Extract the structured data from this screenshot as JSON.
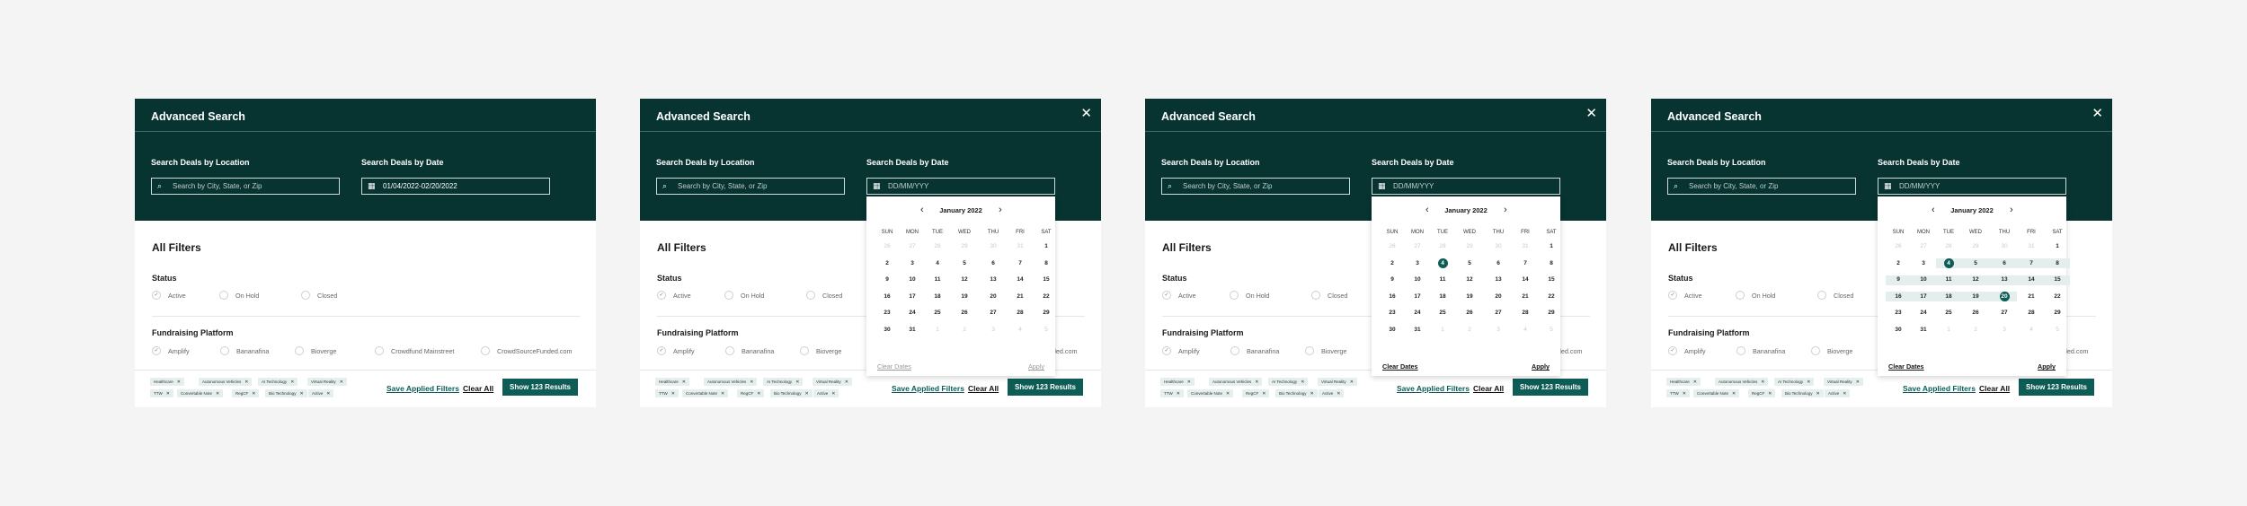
{
  "panels": [
    {
      "title": "Advanced Search",
      "location_label": "Search Deals by Location",
      "location_placeholder": "Search by City, State, or Zip",
      "date_label": "Search Deals by Date",
      "date_value": "01/04/2022-02/20/2022",
      "show_close": false,
      "calendar": null
    },
    {
      "title": "Advanced Search",
      "location_label": "Search Deals by Location",
      "location_placeholder": "Search by City, State, or Zip",
      "date_label": "Search Deals by Date",
      "date_value": "DD/MM/YYY",
      "show_close": true,
      "calendar": {
        "selected": [],
        "range": [],
        "actions_enabled": false
      }
    },
    {
      "title": "Advanced Search",
      "location_label": "Search Deals by Location",
      "location_placeholder": "Search by City, State, or Zip",
      "date_label": "Search Deals by Date",
      "date_value": "DD/MM/YYY",
      "show_close": true,
      "calendar": {
        "selected": [
          4
        ],
        "range": [],
        "actions_enabled": true
      }
    },
    {
      "title": "Advanced Search",
      "location_label": "Search Deals by Location",
      "location_placeholder": "Search by City, State, or Zip",
      "date_label": "Search Deals by Date",
      "date_value": "DD/MM/YYY",
      "show_close": true,
      "calendar": {
        "selected": [
          4,
          20
        ],
        "range": [
          4,
          20
        ],
        "actions_enabled": true
      }
    }
  ],
  "close_glyph": "✕",
  "calendar": {
    "month_label": "January 2022",
    "prev_glyph": "‹",
    "next_glyph": "›",
    "weekdays": [
      "SUN",
      "MON",
      "TUE",
      "WED",
      "THU",
      "FRI",
      "SAT"
    ],
    "weeks": [
      [
        {
          "d": "26",
          "m": true
        },
        {
          "d": "27",
          "m": true
        },
        {
          "d": "28",
          "m": true
        },
        {
          "d": "29",
          "m": true
        },
        {
          "d": "30",
          "m": true
        },
        {
          "d": "31",
          "m": true
        },
        {
          "d": "1",
          "m": false
        }
      ],
      [
        {
          "d": "2",
          "m": false
        },
        {
          "d": "3",
          "m": false
        },
        {
          "d": "4",
          "m": false
        },
        {
          "d": "5",
          "m": false
        },
        {
          "d": "6",
          "m": false
        },
        {
          "d": "7",
          "m": false
        },
        {
          "d": "8",
          "m": false
        }
      ],
      [
        {
          "d": "9",
          "m": false
        },
        {
          "d": "10",
          "m": false
        },
        {
          "d": "11",
          "m": false
        },
        {
          "d": "12",
          "m": false
        },
        {
          "d": "13",
          "m": false
        },
        {
          "d": "14",
          "m": false
        },
        {
          "d": "15",
          "m": false
        }
      ],
      [
        {
          "d": "16",
          "m": false
        },
        {
          "d": "17",
          "m": false
        },
        {
          "d": "18",
          "m": false
        },
        {
          "d": "19",
          "m": false
        },
        {
          "d": "20",
          "m": false
        },
        {
          "d": "21",
          "m": false
        },
        {
          "d": "22",
          "m": false
        }
      ],
      [
        {
          "d": "23",
          "m": false
        },
        {
          "d": "24",
          "m": false
        },
        {
          "d": "25",
          "m": false
        },
        {
          "d": "26",
          "m": false
        },
        {
          "d": "27",
          "m": false
        },
        {
          "d": "28",
          "m": false
        },
        {
          "d": "29",
          "m": false
        }
      ],
      [
        {
          "d": "30",
          "m": false
        },
        {
          "d": "31",
          "m": false
        },
        {
          "d": "1",
          "m": true
        },
        {
          "d": "2",
          "m": true
        },
        {
          "d": "3",
          "m": true
        },
        {
          "d": "4",
          "m": true
        },
        {
          "d": "5",
          "m": true
        }
      ]
    ],
    "clear_label": "Clear Dates",
    "apply_label": "Apply"
  },
  "filters": {
    "title": "All Filters",
    "status": {
      "title": "Status",
      "options": [
        {
          "label": "Active",
          "checked": true
        },
        {
          "label": "On Hold",
          "checked": false
        },
        {
          "label": "Closed",
          "checked": false
        }
      ]
    },
    "platform": {
      "title": "Fundraising Platform",
      "options": [
        {
          "label": "Amplify",
          "checked": true
        },
        {
          "label": "Bananafina",
          "checked": false
        },
        {
          "label": "Bioverge",
          "checked": false
        },
        {
          "label": "Crowdfund Mainstreet",
          "checked": false
        },
        {
          "label": "CrowdSourceFunded.com",
          "checked": false
        }
      ]
    },
    "check_glyph": "✓"
  },
  "chips": {
    "row1": [
      "Healthcare",
      "Autonomous Vehicles",
      "AI Technology",
      "Virtual Reality"
    ],
    "row2": [
      "TTW",
      "Convertable Note",
      "RegCF",
      "Bio Technology",
      "Active"
    ],
    "remove_glyph": "✕"
  },
  "footer": {
    "save_label": "Save Applied Filters",
    "clear_label": "Clear All",
    "show_label": "Show 123 Results"
  },
  "icons": {
    "search": "⌕",
    "calendar": "▦"
  },
  "colors": {
    "header_bg": "#073330",
    "accent": "#0d5c56",
    "chip_bg": "#e5efee",
    "page_bg": "#f4f4f4"
  }
}
